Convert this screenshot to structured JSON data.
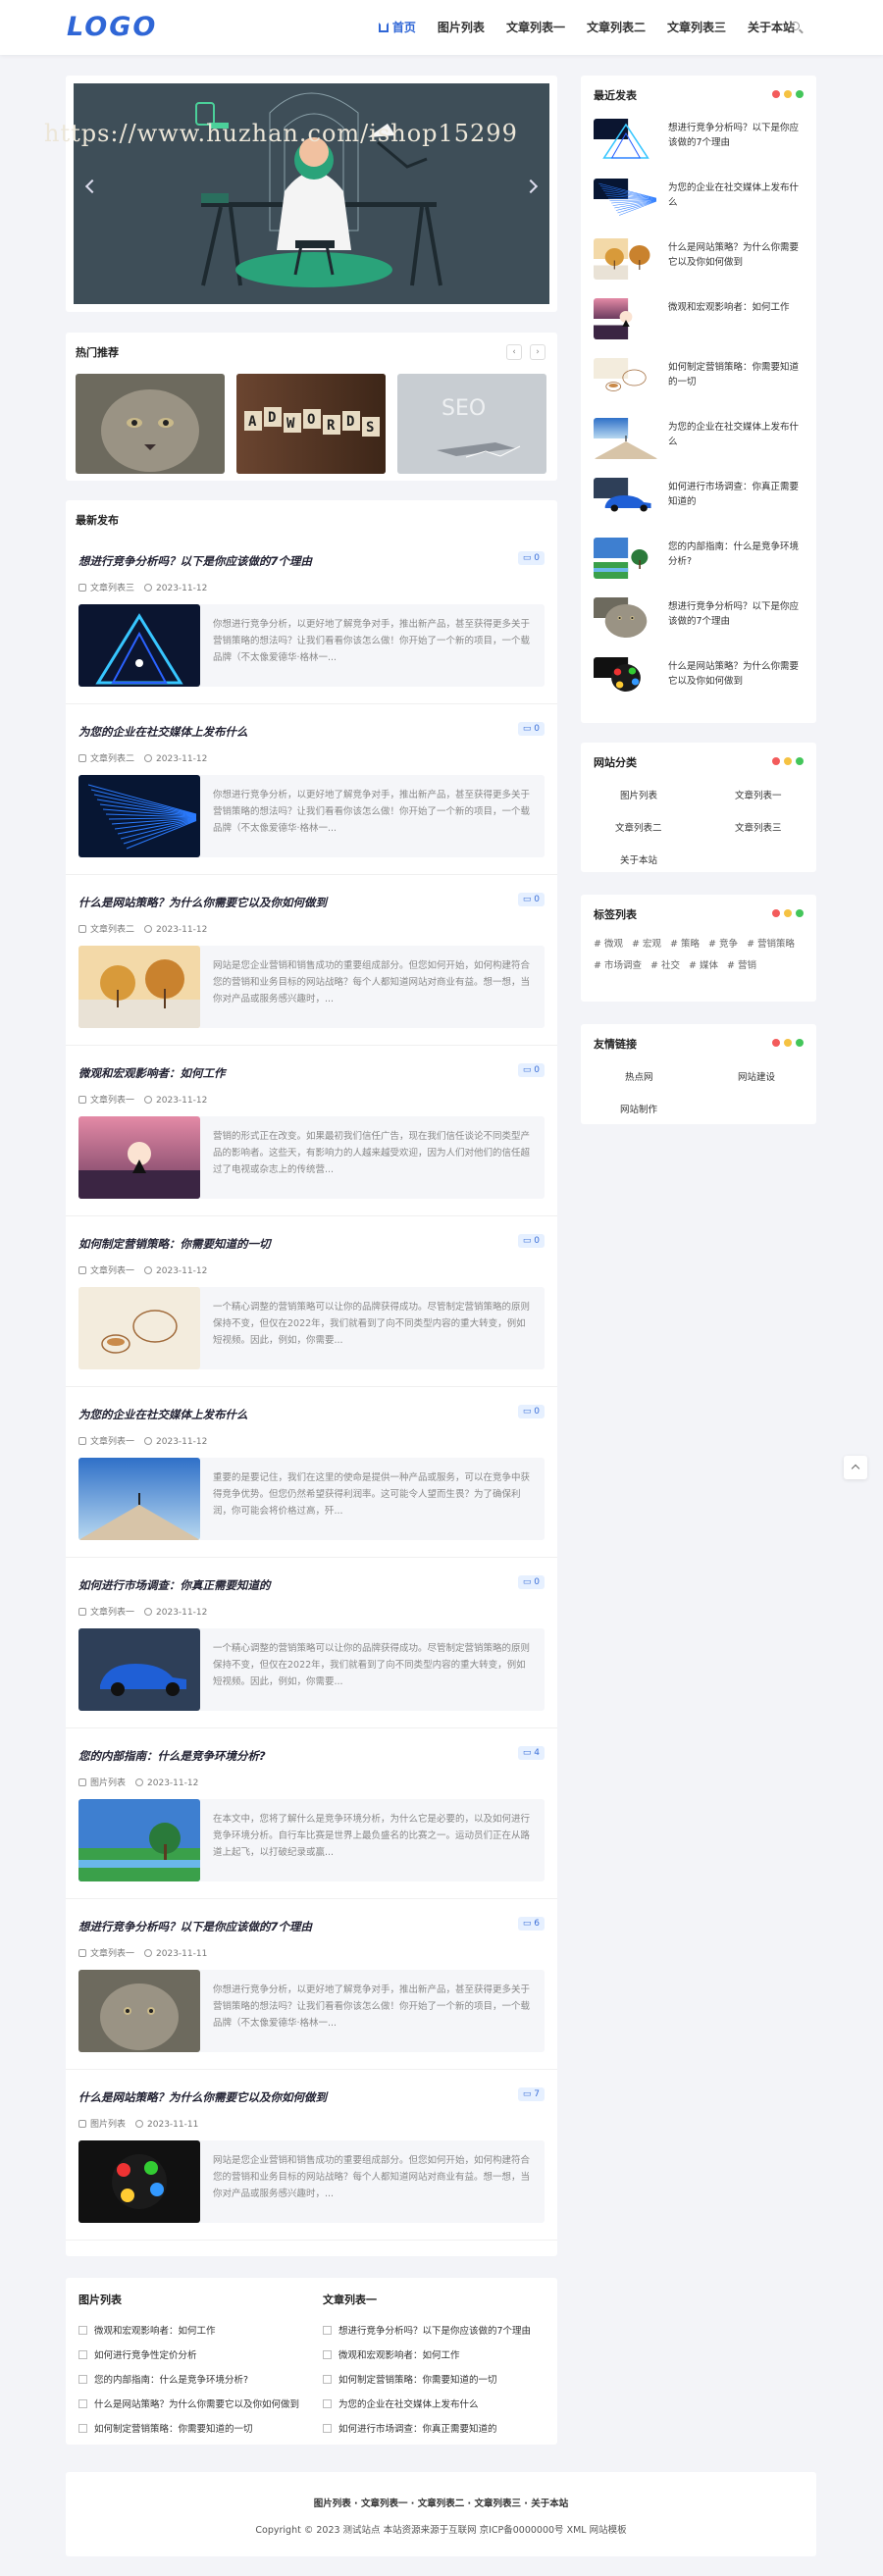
{
  "header": {
    "logo": "LOGO",
    "nav": [
      {
        "label": "首页",
        "active": true
      },
      {
        "label": "图片列表"
      },
      {
        "label": "文章列表一"
      },
      {
        "label": "文章列表二"
      },
      {
        "label": "文章列表三"
      },
      {
        "label": "关于本站"
      }
    ]
  },
  "watermark": "https://www.huzhan.com/ishop15299",
  "hot": {
    "title": "热门推荐",
    "prev": "‹",
    "next": "›",
    "images": [
      {
        "icon": "lynx-photo"
      },
      {
        "icon": "adwords-tiles-photo",
        "text": "ADWORDS"
      },
      {
        "icon": "seo-laptop-photo",
        "text": "SEO"
      }
    ]
  },
  "latest": {
    "title": "最新发布",
    "posts": [
      {
        "title": "想进行竞争分析吗？以下是你应该做的7个理由",
        "category": "文章列表三",
        "date": "2023-11-12",
        "comments": "0",
        "excerpt": "你想进行竞争分析，以更好地了解竞争对手，推出新产品，甚至获得更多关于营销策略的想法吗？让我们看看你该怎么做！你开始了一个新的项目，一个载品牌（不太像爱德华·格林一...",
        "image": "neon-triangle"
      },
      {
        "title": "为您的企业在社交媒体上发布什么",
        "category": "文章列表二",
        "date": "2023-11-12",
        "comments": "0",
        "excerpt": "你想进行竞争分析，以更好地了解竞争对手，推出新产品，甚至获得更多关于营销策略的想法吗？让我们看看你该怎么做！你开始了一个新的项目，一个载品牌（不太像爱德华·格林一...",
        "image": "data-stream"
      },
      {
        "title": "什么是网站策略？为什么你需要它以及你如何做到",
        "category": "文章列表二",
        "date": "2023-11-12",
        "comments": "0",
        "excerpt": "网站是您企业营销和销售成功的重要组成部分。但您如何开始，如何构建符合您的营销和业务目标的网站战略？每个人都知道网站对商业有益。想一想，当你对产品或服务感兴趣时，...",
        "image": "two-trees"
      },
      {
        "title": "微观和宏观影响者：如何工作",
        "category": "文章列表一",
        "date": "2023-11-12",
        "comments": "0",
        "excerpt": "营销的形式正在改变。如果最初我们信任广告，现在我们信任谈论不同类型产品的影响者。这些天，有影响力的人越来越受欢迎，因为人们对他们的信任超过了电视或杂志上的传统营...",
        "image": "pink-sunset"
      },
      {
        "title": "如何制定营销策略：你需要知道的一切",
        "category": "文章列表一",
        "date": "2023-11-12",
        "comments": "0",
        "excerpt": "一个精心调整的营销策略可以让你的品牌获得成功。尽管制定营销策略的原则保持不变，但仅在2022年，我们就看到了向不同类型内容的重大转变，例如短视频。因此，例如，你需要...",
        "image": "teapot"
      },
      {
        "title": "为您的企业在社交媒体上发布什么",
        "category": "文章列表一",
        "date": "2023-11-12",
        "comments": "0",
        "excerpt": "重要的是要记住，我们在这里的使命是提供一种产品或服务，可以在竞争中获得竞争优势。但您仍然希望获得利润率。这可能令人望而生畏？为了确保利润，你可能会将价格过高，歼...",
        "image": "pier"
      },
      {
        "title": "如何进行市场调查：你真正需要知道的",
        "category": "文章列表一",
        "date": "2023-11-12",
        "comments": "0",
        "excerpt": "一个精心调整的营销策略可以让你的品牌获得成功。尽管制定营销策略的原则保持不变，但仅在2022年，我们就看到了向不同类型内容的重大转变，例如短视频。因此，例如，你需要...",
        "image": "blue-car"
      },
      {
        "title": "您的内部指南：什么是竞争环境分析?",
        "category": "图片列表",
        "date": "2023-11-12",
        "comments": "4",
        "excerpt": "在本文中，您将了解什么是竞争环境分析，为什么它是必要的，以及如何进行竞争环境分析。自行车比赛是世界上最负盛名的比赛之一。运动员们正在从路道上起飞，以打破纪录或赢...",
        "image": "painted-landscape"
      },
      {
        "title": "想进行竞争分析吗？以下是你应该做的7个理由",
        "category": "文章列表一",
        "date": "2023-11-11",
        "comments": "6",
        "excerpt": "你想进行竞争分析，以更好地了解竞争对手，推出新产品，甚至获得更多关于营销策略的想法吗？让我们看看你该怎么做！你开始了一个新的项目，一个载品牌（不太像爱德华·格林一...",
        "image": "lynx"
      },
      {
        "title": "什么是网站策略？为什么你需要它以及你如何做到",
        "category": "图片列表",
        "date": "2023-11-11",
        "comments": "7",
        "excerpt": "网站是您企业营销和销售成功的重要组成部分。但您如何开始，如何构建符合您的营销和业务目标的网站战略？每个人都知道网站对商业有益。想一想，当你对产品或服务感兴趣时，...",
        "image": "app-icons"
      }
    ]
  },
  "sidebar": {
    "recent": {
      "title": "最近发表",
      "items": [
        {
          "title": "想进行竞争分析吗？以下是你应该做的7个理由",
          "image": "neon-triangle"
        },
        {
          "title": "为您的企业在社交媒体上发布什么",
          "image": "data-stream"
        },
        {
          "title": "什么是网站策略？为什么你需要它以及你如何做到",
          "image": "two-trees"
        },
        {
          "title": "微观和宏观影响者：如何工作",
          "image": "pink-sunset"
        },
        {
          "title": "如何制定营销策略：你需要知道的一切",
          "image": "teapot"
        },
        {
          "title": "为您的企业在社交媒体上发布什么",
          "image": "pier"
        },
        {
          "title": "如何进行市场调查：你真正需要知道的",
          "image": "blue-car"
        },
        {
          "title": "您的内部指南：什么是竞争环境分析?",
          "image": "painted-landscape"
        },
        {
          "title": "想进行竞争分析吗？以下是你应该做的7个理由",
          "image": "lynx"
        },
        {
          "title": "什么是网站策略？为什么你需要它以及你如何做到",
          "image": "app-icons"
        }
      ]
    },
    "categories": {
      "title": "网站分类",
      "items": [
        "图片列表",
        "文章列表一",
        "文章列表二",
        "文章列表三",
        "关于本站"
      ]
    },
    "tags": {
      "title": "标签列表",
      "items": [
        "# 微观",
        "# 宏观",
        "# 策略",
        "# 竞争",
        "# 营销策略",
        "# 市场调查",
        "# 社交",
        "# 媒体",
        "# 营销"
      ]
    },
    "links": {
      "title": "友情链接",
      "items": [
        "热点网",
        "网站建设",
        "网站制作"
      ]
    }
  },
  "bottom": {
    "col1": {
      "title": "图片列表",
      "items": [
        "微观和宏观影响者：如何工作",
        "如何进行竞争性定价分析",
        "您的内部指南：什么是竞争环境分析?",
        "什么是网站策略？为什么你需要它以及你如何做到",
        "如何制定营销策略：你需要知道的一切"
      ]
    },
    "col2": {
      "title": "文章列表一",
      "items": [
        "想进行竞争分析吗？以下是你应该做的7个理由",
        "微观和宏观影响者：如何工作",
        "如何制定营销策略：你需要知道的一切",
        "为您的企业在社交媒体上发布什么",
        "如何进行市场调查：你真正需要知道的"
      ]
    }
  },
  "footer": {
    "links": [
      "图片列表",
      "文章列表一",
      "文章列表二",
      "文章列表三",
      "关于本站"
    ],
    "separator": " · ",
    "copyright": "Copyright © 2023 测试站点 本站资源来源于互联网 京ICP备0000000号 XML 网站模板"
  },
  "colors": {
    "accent": "#2f66d6",
    "dot_red": "#f35b5b",
    "dot_yellow": "#f5c242",
    "dot_green": "#43c65a"
  }
}
